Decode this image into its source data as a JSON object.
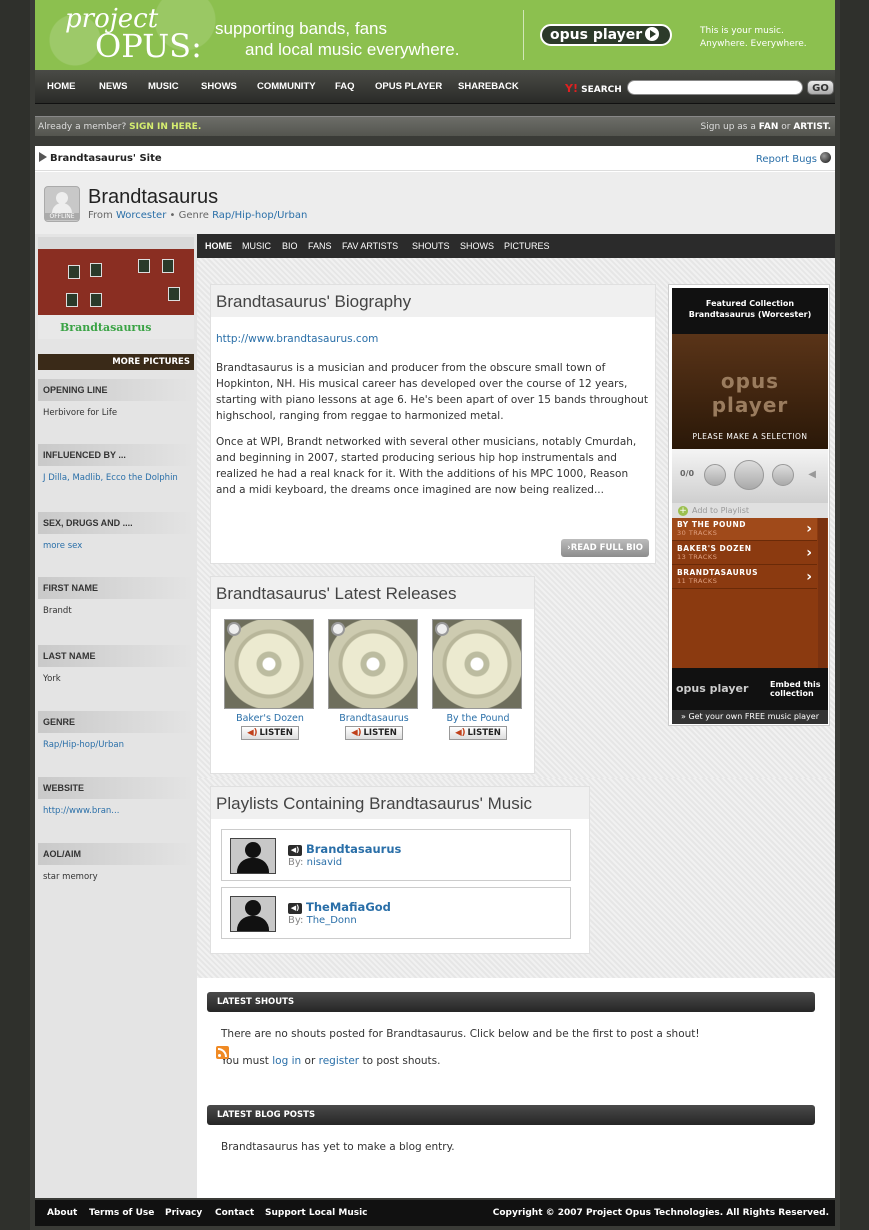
{
  "header": {
    "logo_top": "project",
    "logo_bottom": "OPUS:",
    "tagline_1": "supporting bands, fans",
    "tagline_2": "and local music everywhere.",
    "player_logo": "opus player",
    "right_1": "This is your music.",
    "right_2": "Anywhere. Everywhere."
  },
  "nav": {
    "items": [
      "HOME",
      "NEWS",
      "MUSIC",
      "SHOWS",
      "COMMUNITY",
      "FAQ",
      "OPUS PLAYER",
      "SHAREBACK"
    ],
    "search_label": "SEARCH",
    "search_placeholder": "",
    "go": "GO"
  },
  "member": {
    "prefix": "Already a member?",
    "signin": "SIGN IN HERE.",
    "signup_prefix": "Sign up as a",
    "fan": "FAN",
    "or": "or",
    "artist": "ARTIST."
  },
  "site": {
    "title": "Brandtasaurus' Site",
    "report": "Report Bugs"
  },
  "profile": {
    "status": "OFFLINE",
    "name": "Brandtasaurus",
    "from_label": "From",
    "city": "Worcester",
    "genre_label": "• Genre",
    "genre": "Rap/Hip-hop/Urban"
  },
  "tabs": [
    "HOME",
    "MUSIC",
    "BIO",
    "FANS",
    "FAV ARTISTS",
    "SHOUTS",
    "SHOWS",
    "PICTURES"
  ],
  "sidebar": {
    "photo_caption": "Brandtasaurus",
    "more_pictures": "MORE PICTURES",
    "fields": [
      {
        "label": "OPENING LINE",
        "value": "Herbivore for Life"
      },
      {
        "label": "INFLUENCED BY ...",
        "value": "J Dilla, Madlib, Ecco the Dolphin"
      },
      {
        "label": "SEX, DRUGS AND ....",
        "value": "more sex"
      },
      {
        "label": "FIRST NAME",
        "value": "Brandt"
      },
      {
        "label": "LAST NAME",
        "value": "York"
      },
      {
        "label": "GENRE",
        "value": "Rap/Hip-hop/Urban"
      },
      {
        "label": "WEBSITE",
        "value": "http://www.bran..."
      },
      {
        "label": "AOL/AIM",
        "value": "star memory"
      }
    ]
  },
  "bio": {
    "title": "Brandtasaurus' Biography",
    "link": "http://www.brandtasaurus.com",
    "p1": "Brandtasaurus is a musician and producer from the obscure small town of Hopkinton, NH. His musical career has developed over the course of 12 years, starting with piano lessons at age 6. He's been apart of over 15 bands throughout highschool, ranging from reggae to harmonized metal.",
    "p2": "Once at WPI, Brandt networked with several other musicians, notably Cmurdah, and beginning in 2007, started producing serious hip hop instrumentals and realized he had a real knack for it. With the additions of his MPC 1000, Reason and a midi keyboard, the dreams once imagined are now being realized...",
    "read_full": "READ FULL BIO"
  },
  "releases": {
    "title": "Brandtasaurus' Latest Releases",
    "listen": "LISTEN",
    "items": [
      "Baker's Dozen",
      "Brandtasaurus",
      "By the Pound"
    ]
  },
  "playlists": {
    "title": "Playlists Containing Brandtasaurus' Music",
    "by": "By:",
    "items": [
      {
        "name": "Brandtasaurus",
        "by": "nisavid"
      },
      {
        "name": "TheMafiaGod",
        "by": "The_Donn"
      }
    ]
  },
  "player": {
    "featured": "Featured Collection",
    "collection": "Brandtasaurus (Worcester)",
    "logo": "opus player",
    "select": "PLEASE MAKE A SELECTION",
    "count": "0/0",
    "add": "Add to Playlist",
    "list": [
      {
        "name": "BY THE POUND",
        "tracks": "30 TRACKS"
      },
      {
        "name": "BAKER'S DOZEN",
        "tracks": "13 TRACKS"
      },
      {
        "name": "BRANDTASAURUS",
        "tracks": "11 TRACKS"
      }
    ],
    "embed_1": "Embed this",
    "embed_2": "collection",
    "get": "» Get your own FREE music player"
  },
  "shouts": {
    "title": "LATEST SHOUTS",
    "none": "There are no shouts posted for Brandtasaurus. Click below and be the first to post a shout!",
    "must": "You must",
    "login": "log in",
    "or": "or",
    "register": "register",
    "suffix": "to post shouts."
  },
  "blog": {
    "title": "LATEST BLOG POSTS",
    "none": "Brandtasaurus has yet to make a blog entry."
  },
  "footer": {
    "links": [
      "About",
      "Terms of Use",
      "Privacy",
      "Contact",
      "Support Local Music"
    ],
    "copyright": "Copyright © 2007 Project Opus Technologies. All Rights Reserved."
  }
}
